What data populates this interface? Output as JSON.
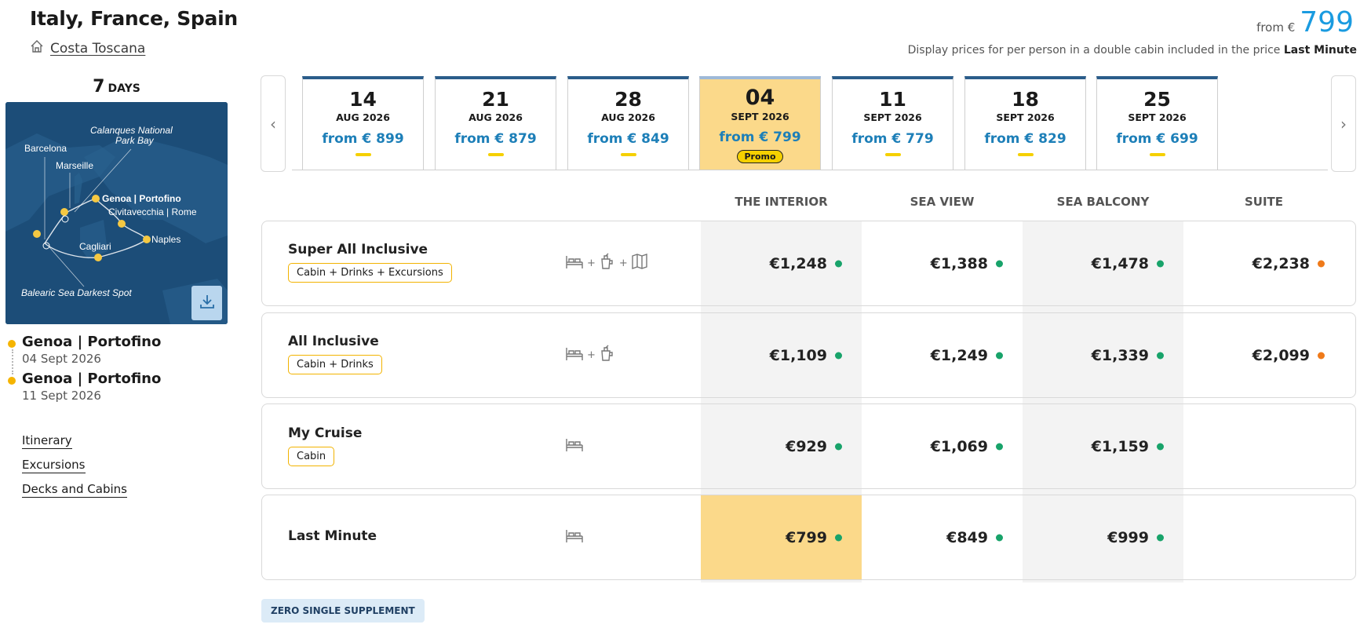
{
  "header": {
    "title": "Italy, France, Spain",
    "ship_name": "Costa Toscana",
    "price_prefix": "from €",
    "price_value": "799",
    "disclaimer_prefix": "Display prices for per person in a double cabin included in the price",
    "disclaimer_bold": "Last Minute"
  },
  "cruise": {
    "days_number": "7",
    "days_label": "DAYS",
    "map_labels": {
      "calanques": "Calanques National",
      "calanques2": "Park Bay",
      "barcelona": "Barcelona",
      "marseille": "Marseille",
      "genoa": "Genoa | Portofino",
      "civitavecchia": "Civitavecchia | Rome",
      "naples": "Naples",
      "cagliari": "Cagliari",
      "balearic": "Balearic Sea Darkest Spot"
    },
    "ports": [
      {
        "name": "Genoa | Portofino",
        "date": "04 Sept 2026"
      },
      {
        "name": "Genoa | Portofino",
        "date": "11 Sept 2026"
      }
    ],
    "links": [
      "Itinerary",
      "Excursions",
      "Decks and Cabins"
    ]
  },
  "dates": [
    {
      "day": "14",
      "month": "AUG 2026",
      "price": "from € 899"
    },
    {
      "day": "21",
      "month": "AUG 2026",
      "price": "from € 879"
    },
    {
      "day": "28",
      "month": "AUG 2026",
      "price": "from € 849"
    },
    {
      "day": "04",
      "month": "SEPT 2026",
      "price": "from € 799",
      "promo": "Promo"
    },
    {
      "day": "11",
      "month": "SEPT 2026",
      "price": "from € 779"
    },
    {
      "day": "18",
      "month": "SEPT 2026",
      "price": "from € 829"
    },
    {
      "day": "25",
      "month": "SEPT 2026",
      "price": "from € 699"
    }
  ],
  "columns": [
    "THE INTERIOR",
    "SEA VIEW",
    "SEA BALCONY",
    "SUITE"
  ],
  "packages": [
    {
      "name": "Super All Inclusive",
      "tag": "Cabin + Drinks + Excursions",
      "prices": [
        "€1,248",
        "€1,388",
        "€1,478",
        "€2,238"
      ]
    },
    {
      "name": "All Inclusive",
      "tag": "Cabin + Drinks",
      "prices": [
        "€1,109",
        "€1,249",
        "€1,339",
        "€2,099"
      ]
    },
    {
      "name": "My Cruise",
      "tag": "Cabin",
      "prices": [
        "€929",
        "€1,069",
        "€1,159"
      ]
    },
    {
      "name": "Last Minute",
      "prices": [
        "€799",
        "€849",
        "€999"
      ]
    }
  ],
  "badge": "ZERO SINGLE SUPPLEMENT",
  "colors": {
    "accent_blue": "#1a9be0",
    "price_blue": "#1d7fb8",
    "highlight_yellow": "#fbd98a",
    "tag_border": "#f2b300",
    "availability_green": "#18a36a",
    "availability_orange": "#ef7a1a"
  },
  "icons": [
    "home-icon",
    "download-icon",
    "chevron-left-icon",
    "chevron-right-icon",
    "bed-icon",
    "drink-icon",
    "map-icon"
  ]
}
